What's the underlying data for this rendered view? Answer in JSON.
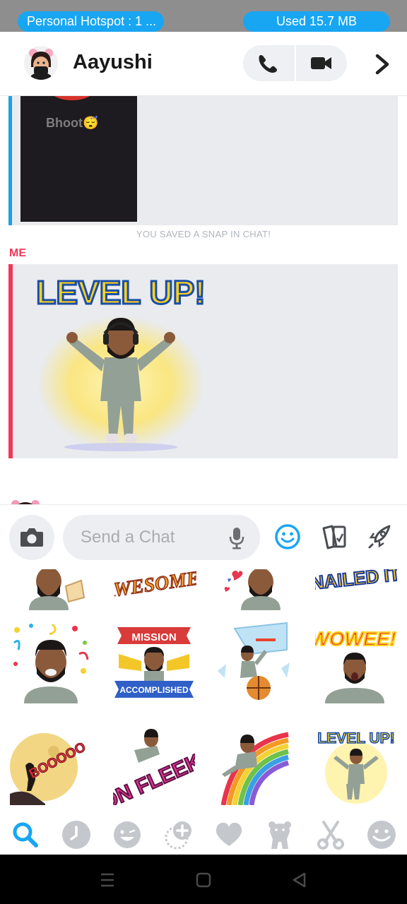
{
  "status_bar": {
    "hotspot_text": "Personal Hotspot : 1 ...",
    "data_used_text": "Used  15.7 MB",
    "pill_color": "#18a6f2"
  },
  "header": {
    "contact_name": "Aayushi",
    "icons": [
      "avatar",
      "phone-icon",
      "video-camera-icon",
      "chevron-right-icon"
    ]
  },
  "chat": {
    "snap_caption": "Bhoot😴",
    "saved_note": "YOU SAVED A SNAP IN CHAT!",
    "sender_label": "ME",
    "sticker_text": "LEVEL UP!",
    "sender_color": "#f0385a",
    "other_color": "#1aa0e8"
  },
  "input": {
    "placeholder": "Send a Chat",
    "value": ""
  },
  "stickers": [
    {
      "text": ""
    },
    {
      "text": "AWESOME!"
    },
    {
      "text": ""
    },
    {
      "text": "NAILED IT"
    },
    {
      "text": ""
    },
    {
      "text_top": "MISSION",
      "text_bottom": "ACCOMPLISHED"
    },
    {
      "text": ""
    },
    {
      "text": "WOWEE!"
    },
    {
      "text": "BOOOOO"
    },
    {
      "text": "ON FLEEK"
    },
    {
      "text": ""
    },
    {
      "text": "LEVEL UP!"
    }
  ],
  "tabs": [
    "search-icon",
    "recent-clock-icon",
    "smiley-icon",
    "friendmoji-icon",
    "heart-icon",
    "bear-icon",
    "scissors-icon",
    "emoji-icon"
  ],
  "accent_color": "#18a6f2"
}
